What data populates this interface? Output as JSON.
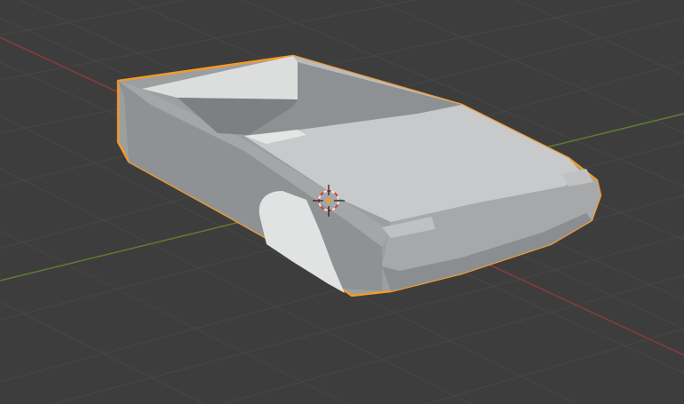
{
  "viewport": {
    "background_color": "#3d3d3d",
    "grid_color": "#4a4a4a",
    "x_axis_color": "#8b3a3a",
    "y_axis_color": "#5f7d32",
    "selection_outline_color": "#f39a2c",
    "object_base_color": "#a7a9ab"
  },
  "object": {
    "semantic": "car-body-mesh",
    "selected": true
  },
  "cursor": {
    "icon": "3d-cursor-icon"
  }
}
